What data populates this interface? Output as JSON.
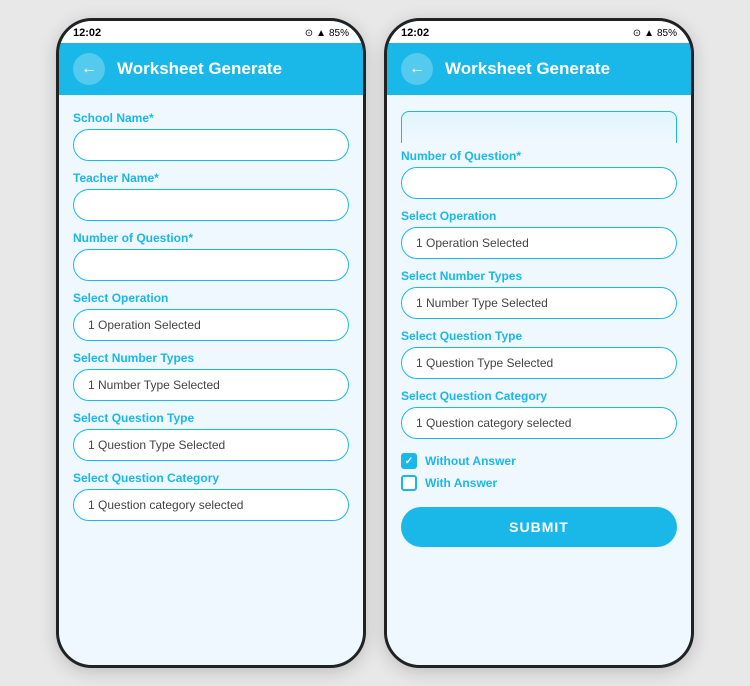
{
  "phone1": {
    "statusBar": {
      "time": "12:02",
      "battery": "85%"
    },
    "header": {
      "title": "Worksheet Generate",
      "backLabel": "←"
    },
    "fields": [
      {
        "label": "School Name*",
        "value": "",
        "placeholder": "",
        "id": "school-name"
      },
      {
        "label": "Teacher Name*",
        "value": "",
        "placeholder": "",
        "id": "teacher-name"
      },
      {
        "label": "Number of Question*",
        "value": "",
        "placeholder": "",
        "id": "num-question"
      },
      {
        "label": "Select Operation",
        "value": "1 Operation Selected",
        "id": "select-operation"
      },
      {
        "label": "Select Number Types",
        "value": "1 Number Type Selected",
        "id": "select-number-types"
      },
      {
        "label": "Select Question Type",
        "value": "1 Question Type Selected",
        "id": "select-question-type"
      },
      {
        "label": "Select Question Category",
        "value": "1 Question category selected",
        "id": "select-question-category"
      }
    ]
  },
  "phone2": {
    "statusBar": {
      "time": "12:02",
      "battery": "85%"
    },
    "header": {
      "title": "Worksheet Generate",
      "backLabel": "←"
    },
    "scrollHint": true,
    "fields": [
      {
        "label": "Number of Question*",
        "value": "",
        "placeholder": "",
        "id": "num-question2"
      },
      {
        "label": "Select Operation",
        "value": "1 Operation Selected",
        "id": "select-operation2"
      },
      {
        "label": "Select Number Types",
        "value": "1 Number Type Selected",
        "id": "select-number-types2"
      },
      {
        "label": "Select Question Type",
        "value": "1 Question Type Selected",
        "id": "select-question-type2"
      },
      {
        "label": "Select Question Category",
        "value": "1 Question category selected",
        "id": "select-question-category2"
      }
    ],
    "checkboxes": [
      {
        "label": "Without Answer",
        "checked": true,
        "id": "without-answer"
      },
      {
        "label": "With Answer",
        "checked": false,
        "id": "with-answer"
      }
    ],
    "submitLabel": "SUBMIT"
  }
}
